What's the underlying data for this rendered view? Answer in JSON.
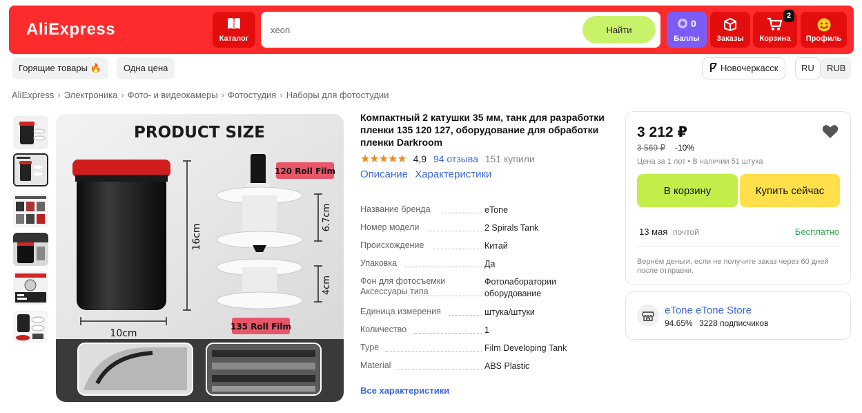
{
  "header": {
    "logo": "AliExpress",
    "catalog_label": "Каталог",
    "search_value": "xeon",
    "search_button": "Найти",
    "points_value": "0",
    "points_label": "Баллы",
    "orders_label": "Заказы",
    "cart_label": "Корзина",
    "cart_count": "2",
    "profile_label": "Профиль"
  },
  "subnav": {
    "hot_deals": "Горящие товары 🔥",
    "one_price": "Одна цена",
    "city": "Новочеркасск",
    "language": "RU",
    "currency": "RUB"
  },
  "breadcrumb": [
    "AliExpress",
    "Электроника",
    "Фото- и видеокамеры",
    "Фотостудия",
    "Наборы для фотостудии"
  ],
  "gallery": {
    "image_heading": "PRODUCT SIZE",
    "label_120": "120 Roll Film",
    "label_135": "135 Roll Film",
    "dim_height": "16cm",
    "dim_width": "10cm",
    "dim_upper": "6.7cm",
    "dim_lower": "4cm"
  },
  "product": {
    "title": "Компактный 2 катушки 35 мм, танк для разработки пленки 135 120 127, оборудование для обработки пленки Darkroom",
    "stars": "★★★★★",
    "rating": "4,9",
    "reviews": "94 отзыва",
    "sold": "151 купили",
    "tab_description": "Описание",
    "tab_specs": "Характеристики",
    "specs": [
      {
        "key": "Название бренда",
        "value": "eTone"
      },
      {
        "key": "Номер модели",
        "value": "2 Spirals Tank"
      },
      {
        "key": "Происхождение",
        "value": "Китай"
      },
      {
        "key": "Упаковка",
        "value": "Да"
      },
      {
        "key": "Фон для фотосъемки Аксессуары типа",
        "value": "Фотолаборатории оборудование"
      },
      {
        "key": "Единица измерения",
        "value": "штука/штуки"
      },
      {
        "key": "Количество",
        "value": "1"
      },
      {
        "key": "Type",
        "value": "Film Developing Tank"
      },
      {
        "key": "Material",
        "value": "ABS Plastic"
      }
    ],
    "all_specs_link": "Все характеристики"
  },
  "buybox": {
    "price": "3 212 ₽",
    "old_price": "3 569 ₽",
    "discount": "-10%",
    "lot_info": "Цена за 1 лот • В наличии 51 штука",
    "add_to_cart": "В корзину",
    "buy_now": "Купить сейчас",
    "delivery_date": "13 мая",
    "delivery_method": "почтой",
    "delivery_price": "Бесплатно",
    "refund_note": "Вернём деньги, если не получите заказ через 60 дней после отправки."
  },
  "store": {
    "name": "eTone eTone Store",
    "rating": "94.65%",
    "subscribers": "3228 подписчиков"
  },
  "colors": {
    "brand_red": "#fd2b2b",
    "points_purple": "#7c5cf6",
    "cart_button": "#c2ee4a",
    "buy_button": "#ffdf4a",
    "link_blue": "#3b68d9",
    "free_green": "#2ca84d"
  }
}
